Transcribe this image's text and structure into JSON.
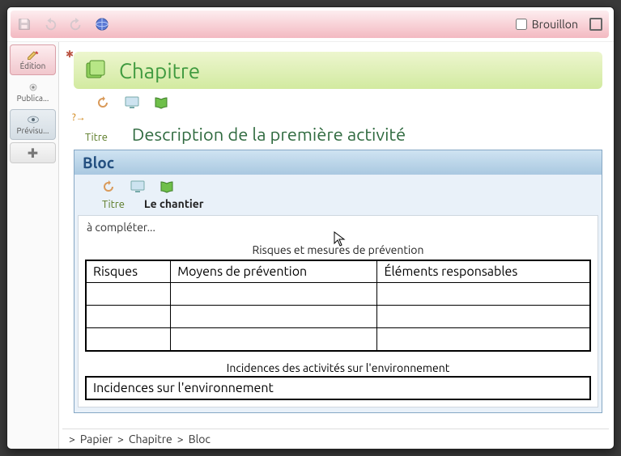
{
  "toolbar": {
    "brouillon_label": "Brouillon"
  },
  "sidebar": {
    "edition_label": "Édition",
    "publica_label": "Publica...",
    "previsu_label": "Prévisu..."
  },
  "chapitre": {
    "title": "Chapitre",
    "titre_label": "Titre",
    "titre_value": "Description de la première activité"
  },
  "bloc": {
    "header": "Bloc",
    "titre_label": "Titre",
    "titre_value": "Le chantier",
    "placeholder": "à compléter..."
  },
  "table1": {
    "caption": "Risques et mesures de prévention",
    "headers": [
      "Risques",
      "Moyens de prévention",
      "Éléments responsables"
    ]
  },
  "table2": {
    "caption": "Incidences des activités sur l'environnement",
    "row": "Incidences sur l'environnement"
  },
  "breadcrumb": {
    "a": "Papier",
    "b": "Chapitre",
    "c": "Bloc"
  },
  "hint": "?→"
}
